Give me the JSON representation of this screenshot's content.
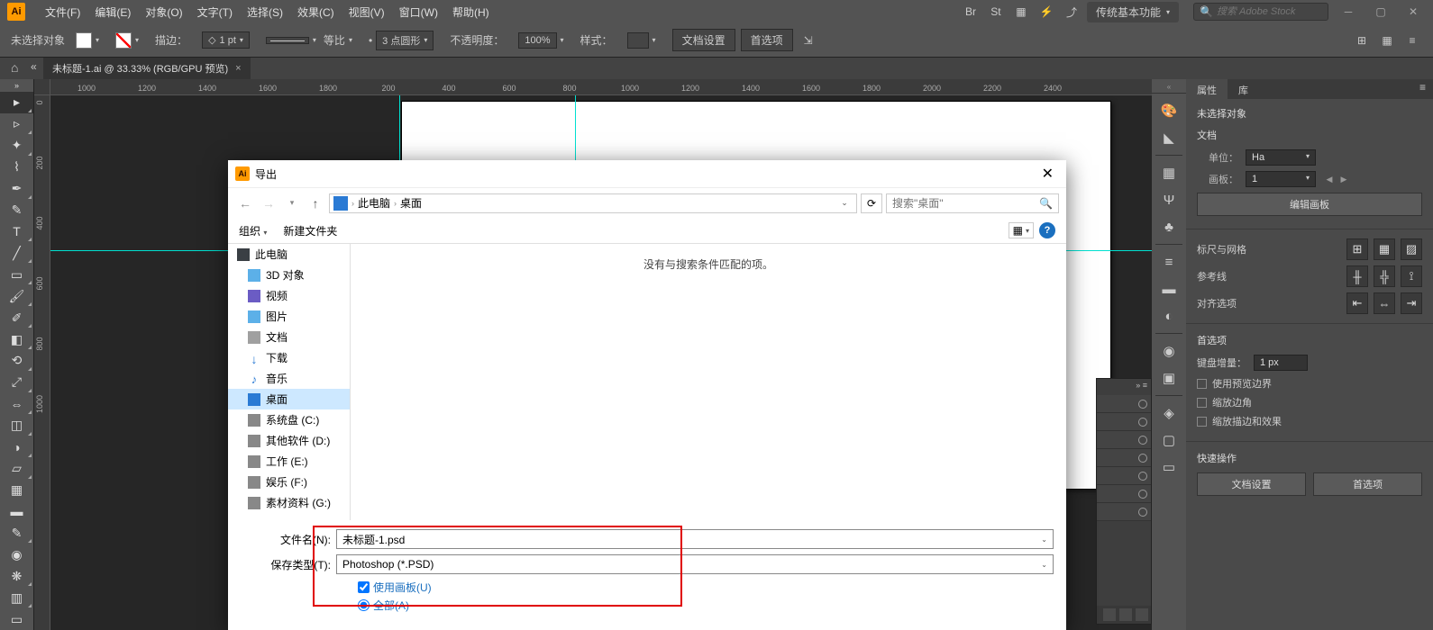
{
  "menubar": {
    "logo": "Ai",
    "items": [
      "文件(F)",
      "编辑(E)",
      "对象(O)",
      "文字(T)",
      "选择(S)",
      "效果(C)",
      "视图(V)",
      "窗口(W)",
      "帮助(H)"
    ],
    "workspace": "传统基本功能",
    "search_placeholder": "搜索 Adobe Stock"
  },
  "controlbar": {
    "no_selection": "未选择对象",
    "stroke_label": "描边：",
    "stroke_width": "1 pt",
    "proportion": "等比",
    "point_round": "3 点圆形",
    "opacity_label": "不透明度：",
    "opacity_val": "100%",
    "style_label": "样式：",
    "doc_setup": "文档设置",
    "prefs": "首选项"
  },
  "tab": {
    "title": "未标题-1.ai @ 33.33% (RGB/GPU 预览)"
  },
  "ruler_h": [
    1000,
    1200,
    1400,
    1600,
    1800,
    200,
    400,
    600,
    800,
    1000,
    1200,
    1400,
    1600,
    1800,
    2000,
    2200,
    2400
  ],
  "ruler_v": [
    0,
    200,
    400,
    600,
    800,
    1000
  ],
  "properties": {
    "tabs": [
      "属性",
      "库"
    ],
    "no_sel": "未选择对象",
    "doc": "文档",
    "unit_label": "单位：",
    "unit_val": "Ha",
    "artboard_label": "画板：",
    "artboard_val": "1",
    "edit_artboard": "编辑画板",
    "ruler_grid": "标尺与网格",
    "guides": "参考线",
    "align_opts": "对齐选项",
    "prefs_sec": "首选项",
    "kbd_inc_label": "键盘增量：",
    "kbd_inc_val": "1 px",
    "use_preview": "使用预览边界",
    "scale_corners": "缩放边角",
    "scale_stroke": "缩放描边和效果",
    "quick_ops": "快速操作",
    "doc_setup_btn": "文档设置",
    "prefs_btn": "首选项"
  },
  "dialog": {
    "title": "导出",
    "breadcrumb": [
      "此电脑",
      "桌面"
    ],
    "search_placeholder": "搜索\"桌面\"",
    "organize": "组织",
    "new_folder": "新建文件夹",
    "tree": [
      {
        "label": "此电脑",
        "icon": "ic-pc",
        "root": true
      },
      {
        "label": "3D 对象",
        "icon": "ic-3d"
      },
      {
        "label": "视频",
        "icon": "ic-vid"
      },
      {
        "label": "图片",
        "icon": "ic-img"
      },
      {
        "label": "文档",
        "icon": "ic-doc"
      },
      {
        "label": "下载",
        "icon": "ic-dl",
        "glyph": "↓"
      },
      {
        "label": "音乐",
        "icon": "ic-mus",
        "glyph": "♪"
      },
      {
        "label": "桌面",
        "icon": "ic-desk",
        "sel": true
      },
      {
        "label": "系统盘 (C:)",
        "icon": "ic-disk"
      },
      {
        "label": "其他软件 (D:)",
        "icon": "ic-disk"
      },
      {
        "label": "工作 (E:)",
        "icon": "ic-disk"
      },
      {
        "label": "娱乐 (F:)",
        "icon": "ic-disk"
      },
      {
        "label": "素材资料 (G:)",
        "icon": "ic-disk"
      }
    ],
    "empty_msg": "没有与搜索条件匹配的项。",
    "filename_label": "文件名(N):",
    "filename_val": "未标题-1.psd",
    "filetype_label": "保存类型(T):",
    "filetype_val": "Photoshop (*.PSD)",
    "use_artboard": "使用画板(U)",
    "all_radio": "全部(A)"
  }
}
